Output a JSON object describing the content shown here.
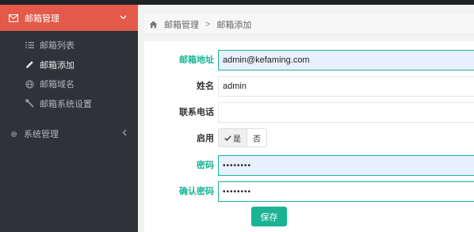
{
  "sidebar": {
    "header": {
      "label": "邮箱管理",
      "icon": "envelope-icon"
    },
    "items": [
      {
        "label": "邮箱列表",
        "icon": "list-icon",
        "active": false
      },
      {
        "label": "邮箱添加",
        "icon": "pencil-icon",
        "active": true
      },
      {
        "label": "邮箱域名",
        "icon": "globe-icon",
        "active": false
      },
      {
        "label": "邮箱系统设置",
        "icon": "wrench-icon",
        "active": false
      }
    ],
    "system": {
      "label": "系统管理",
      "icon": "gear-icon"
    }
  },
  "breadcrumb": {
    "root": "邮箱管理",
    "separator": ">",
    "current": "邮箱添加",
    "icon": "home-icon"
  },
  "form": {
    "email": {
      "label": "邮箱地址",
      "value": "admin@kefaming.com"
    },
    "name": {
      "label": "姓名",
      "value": "admin"
    },
    "phone": {
      "label": "联系电话",
      "value": ""
    },
    "enabled": {
      "label": "启用",
      "yes": "是",
      "no": "否",
      "selected": "是"
    },
    "password": {
      "label": "密码",
      "value": "••••••••"
    },
    "confirm": {
      "label": "确认密码",
      "value": "••••••••"
    },
    "save_label": "保存"
  },
  "colors": {
    "accent": "#1ab394",
    "header_red": "#e35a4a",
    "sidebar_bg": "#2f3337"
  }
}
